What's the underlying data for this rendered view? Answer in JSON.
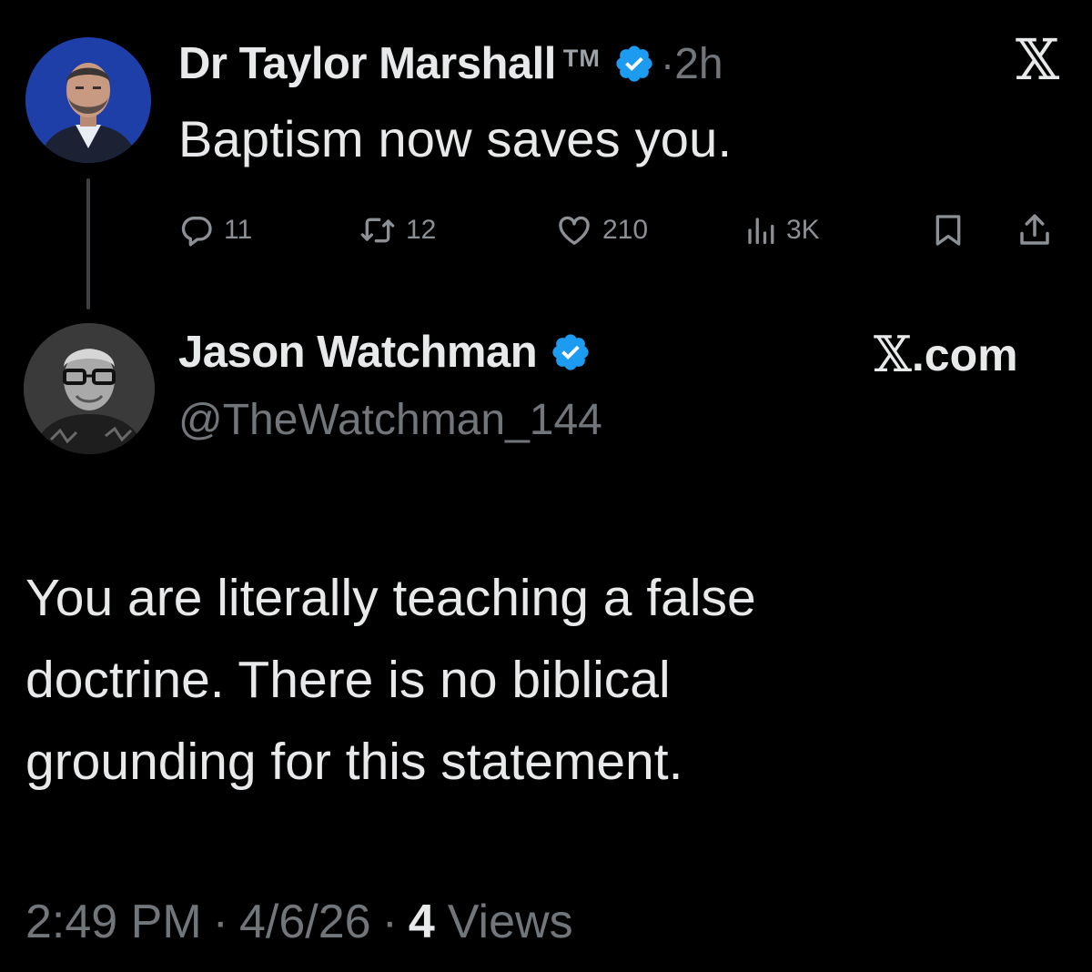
{
  "colors": {
    "background": "#000000",
    "primary_text": "#e7e9ea",
    "secondary_text": "#71767b",
    "verified_blue": "#1d9bf0",
    "thread_line": "#3e4144"
  },
  "parent_tweet": {
    "display_name": "Dr Taylor Marshall",
    "name_suffix": "TM",
    "separator": "·",
    "time_ago": "2h",
    "close_icon": "x-logo-icon",
    "close_glyph": "𝕏",
    "text": "Baptism now saves you.",
    "actions": {
      "replies": "11",
      "reposts": "12",
      "likes": "210",
      "views": "3K"
    }
  },
  "reply_tweet": {
    "display_name": "Jason Watchman",
    "handle": "@TheWatchman_144",
    "brand_glyph": "𝕏",
    "brand_text": ".com",
    "body_lines": [
      "You are literally teaching a false",
      "doctrine. There is no biblical",
      "grounding for this statement."
    ],
    "time": "2:49 PM",
    "date": "4/6/26",
    "separator": "·",
    "views_count": "4",
    "views_label": "Views"
  }
}
